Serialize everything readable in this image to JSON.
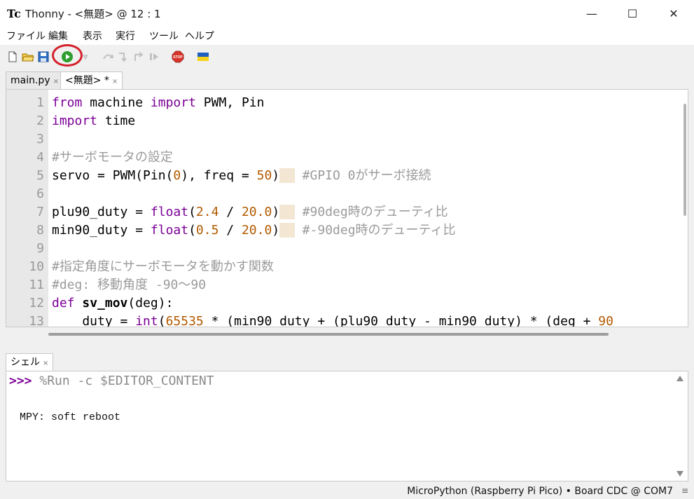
{
  "window": {
    "app_icon": "Tc",
    "title": "Thonny  -  <無題>  @  12 : 1",
    "minimize": "—",
    "maximize": "☐",
    "close": "✕"
  },
  "menu": [
    "ファイル",
    "編集",
    "表示",
    "実行",
    "ツール",
    "ヘルプ"
  ],
  "toolbar": {
    "icons": [
      "new-file-icon",
      "open-file-icon",
      "save-icon",
      "run-icon",
      "debug-icon",
      "step-over-icon",
      "step-into-icon",
      "step-out-icon",
      "resume-icon",
      "stop-icon",
      "ukraine-flag-icon"
    ],
    "stop_label": "STOP",
    "accent_run": "#2e9e2e",
    "accent_stop": "#d8352a",
    "annotation_color": "#d4202a"
  },
  "tabs": [
    {
      "label": "main.py",
      "close": "×",
      "active": false
    },
    {
      "label": "<無題> *",
      "close": "×",
      "active": true
    }
  ],
  "editor": {
    "line_numbers": [
      "1",
      "2",
      "3",
      "4",
      "5",
      "6",
      "7",
      "8",
      "9",
      "10",
      "11",
      "12",
      "13"
    ],
    "lines": [
      [
        {
          "t": "from",
          "c": "kw"
        },
        {
          "t": " machine ",
          "c": ""
        },
        {
          "t": "import",
          "c": "kw"
        },
        {
          "t": " PWM, Pin",
          "c": ""
        }
      ],
      [
        {
          "t": "import",
          "c": "kw"
        },
        {
          "t": " time",
          "c": ""
        }
      ],
      [],
      [
        {
          "t": "#サーボモータの設定",
          "c": "cm"
        }
      ],
      [
        {
          "t": "servo = PWM(Pin(",
          "c": ""
        },
        {
          "t": "0",
          "c": "num"
        },
        {
          "t": "), freq = ",
          "c": ""
        },
        {
          "t": "50",
          "c": "num"
        },
        {
          "t": ")",
          "c": ""
        },
        {
          "t": "  ",
          "c": "pad"
        },
        {
          "t": " #GPIO 0がサーボ接続",
          "c": "cm"
        }
      ],
      [],
      [
        {
          "t": "plu90_duty = ",
          "c": ""
        },
        {
          "t": "float",
          "c": "bi"
        },
        {
          "t": "(",
          "c": ""
        },
        {
          "t": "2.4",
          "c": "num"
        },
        {
          "t": " / ",
          "c": ""
        },
        {
          "t": "20.0",
          "c": "num"
        },
        {
          "t": ")",
          "c": ""
        },
        {
          "t": "  ",
          "c": "pad"
        },
        {
          "t": " #90deg時のデューティ比",
          "c": "cm"
        }
      ],
      [
        {
          "t": "min90_duty = ",
          "c": ""
        },
        {
          "t": "float",
          "c": "bi"
        },
        {
          "t": "(",
          "c": ""
        },
        {
          "t": "0.5",
          "c": "num"
        },
        {
          "t": " / ",
          "c": ""
        },
        {
          "t": "20.0",
          "c": "num"
        },
        {
          "t": ")",
          "c": ""
        },
        {
          "t": "  ",
          "c": "pad"
        },
        {
          "t": " #-90deg時のデューティ比",
          "c": "cm"
        }
      ],
      [],
      [
        {
          "t": "#指定角度にサーボモータを動かす関数",
          "c": "cm"
        }
      ],
      [
        {
          "t": "#deg: 移動角度 -90～90",
          "c": "cm"
        }
      ],
      [
        {
          "t": "def",
          "c": "kw"
        },
        {
          "t": " ",
          "c": ""
        },
        {
          "t": "sv_mov",
          "c": "fn"
        },
        {
          "t": "(deg):",
          "c": ""
        }
      ],
      [
        {
          "t": "    duty = ",
          "c": ""
        },
        {
          "t": "int",
          "c": "bi"
        },
        {
          "t": "(",
          "c": ""
        },
        {
          "t": "65535",
          "c": "num"
        },
        {
          "t": " * (min90_duty + (plu90_duty - min90_duty) * (deg + ",
          "c": ""
        },
        {
          "t": "90",
          "c": "num"
        }
      ]
    ]
  },
  "shell": {
    "tab_label": "シェル",
    "tab_close": "×",
    "prompt": ">>>",
    "command": " %Run -c $EDITOR_CONTENT",
    "output": "MPY: soft reboot"
  },
  "status": {
    "text": "MicroPython (Raspberry Pi Pico)  •  Board CDC @ COM7",
    "grip": "≡"
  }
}
